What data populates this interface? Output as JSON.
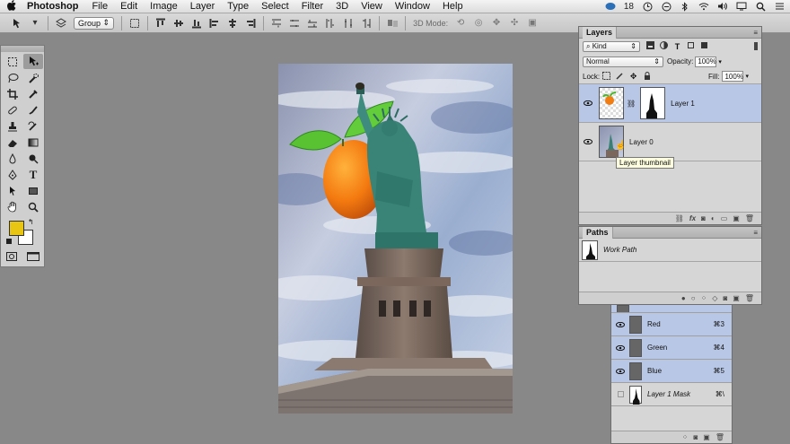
{
  "menubar": {
    "apple": "",
    "app_name": "Photoshop",
    "items": [
      "File",
      "Edit",
      "Image",
      "Layer",
      "Type",
      "Select",
      "Filter",
      "3D",
      "View",
      "Window",
      "Help"
    ],
    "status_badge": "18"
  },
  "options_bar": {
    "auto_select_value": "Group",
    "mode_label": "3D Mode:"
  },
  "layers_panel": {
    "tab": "Layers",
    "filter_kind": "Kind",
    "blend_mode": "Normal",
    "opacity_label": "Opacity:",
    "opacity_value": "100%",
    "lock_label": "Lock:",
    "fill_label": "Fill:",
    "fill_value": "100%",
    "layers": [
      {
        "name": "Layer 1",
        "selected": true
      },
      {
        "name": "Layer 0",
        "selected": false
      }
    ],
    "tooltip": "Layer thumbnail"
  },
  "paths_panel": {
    "tab": "Paths",
    "paths": [
      {
        "name": "Work Path"
      }
    ]
  },
  "channels_panel": {
    "channels": [
      {
        "name": "Red",
        "shortcut": "⌘3",
        "selected": true
      },
      {
        "name": "Green",
        "shortcut": "⌘4",
        "selected": true
      },
      {
        "name": "Blue",
        "shortcut": "⌘5",
        "selected": true
      },
      {
        "name": "Layer 1 Mask",
        "shortcut": "⌘\\",
        "selected": false
      }
    ]
  },
  "colors": {
    "foreground": "#e8c512",
    "background": "#ffffff",
    "selection": "#b8c7e6"
  }
}
